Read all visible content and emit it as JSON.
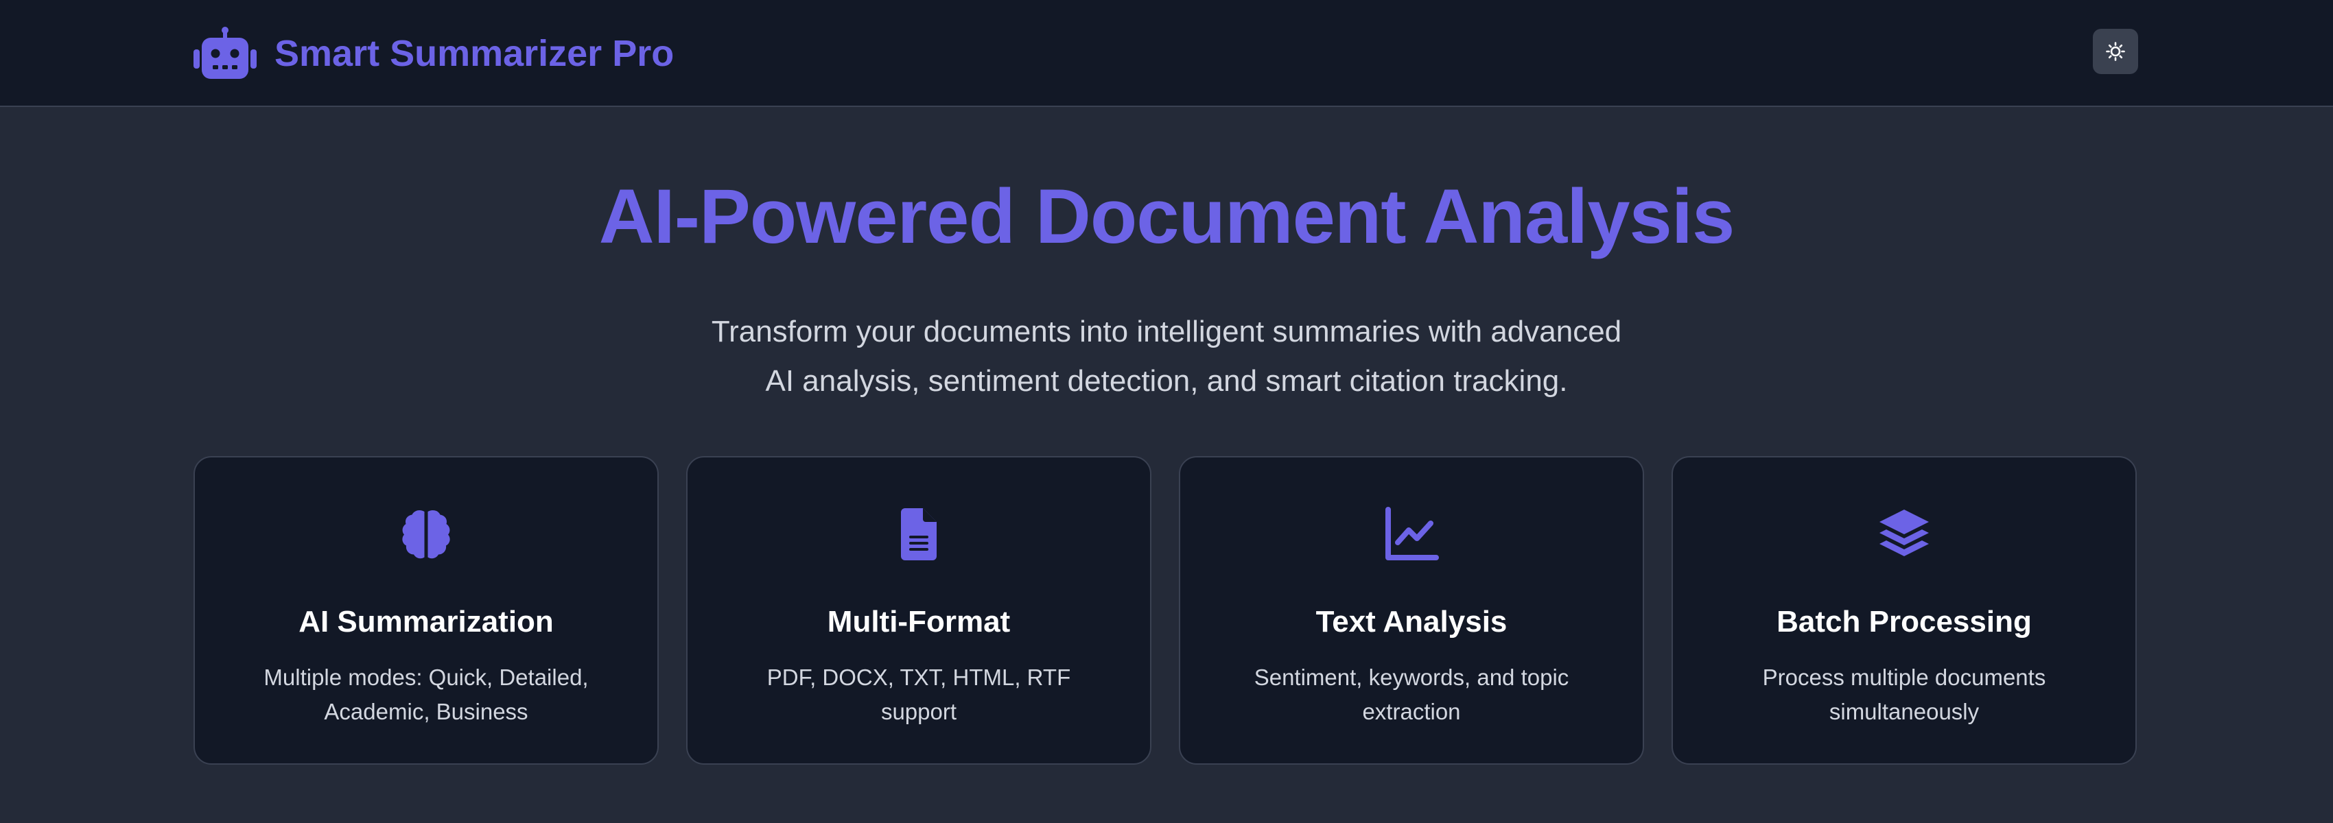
{
  "header": {
    "brand_title": "Smart Summarizer Pro",
    "brand_icon": "robot-icon",
    "theme_toggle_icon": "sun-icon"
  },
  "hero": {
    "title": "AI-Powered Document Analysis",
    "subtitle_line1": "Transform your documents into intelligent summaries with advanced",
    "subtitle_line2": "AI analysis, sentiment detection, and smart citation tracking."
  },
  "features": [
    {
      "icon": "brain-icon",
      "title": "AI Summarization",
      "description": "Multiple modes: Quick, Detailed, Academic, Business"
    },
    {
      "icon": "file-document-icon",
      "title": "Multi-Format",
      "description": "PDF, DOCX, TXT, HTML, RTF support"
    },
    {
      "icon": "chart-line-icon",
      "title": "Text Analysis",
      "description": "Sentiment, keywords, and topic extraction"
    },
    {
      "icon": "layers-icon",
      "title": "Batch Processing",
      "description": "Process multiple documents simultaneously"
    }
  ],
  "colors": {
    "accent": "#6c63e6",
    "page_background": "#242a38",
    "header_background": "#121826",
    "card_background": "#121826",
    "card_border": "#3a4152",
    "text_primary": "#ffffff",
    "text_secondary": "#d3d7e0"
  }
}
